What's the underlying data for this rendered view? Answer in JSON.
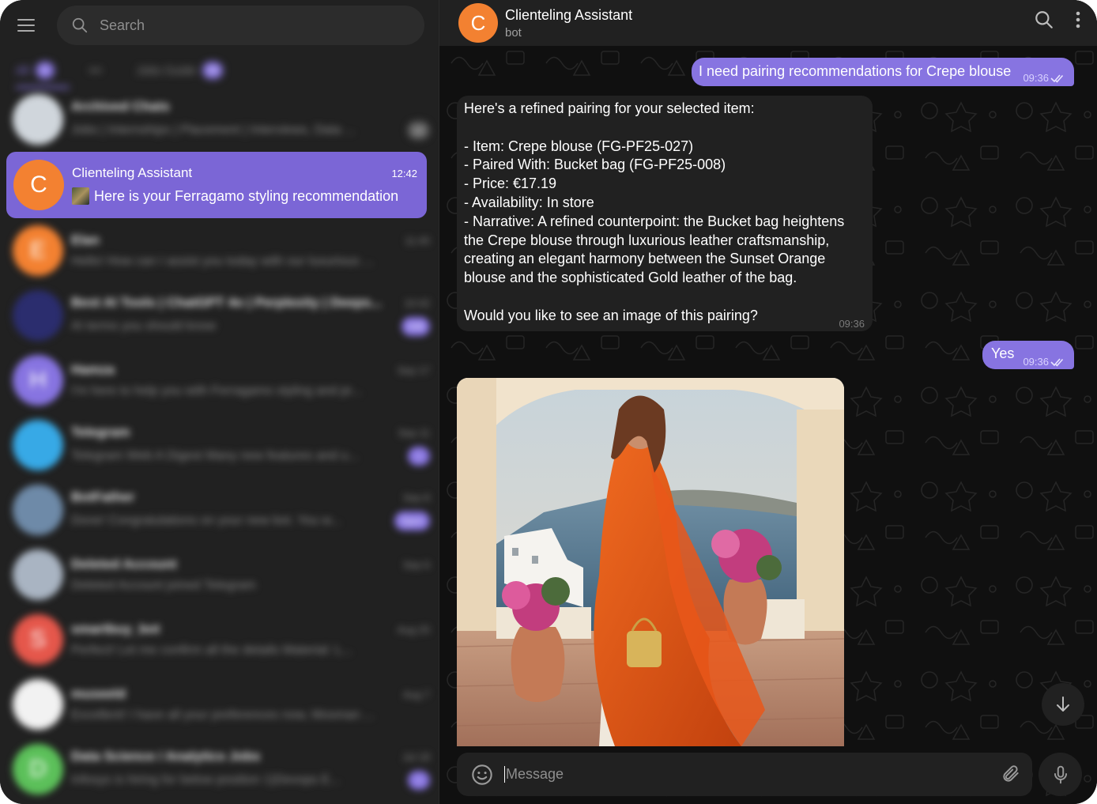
{
  "search": {
    "placeholder": "Search"
  },
  "folders": [
    {
      "label": "All",
      "badge": "8",
      "active": true
    },
    {
      "label": "•••",
      "badge": "",
      "active": false
    },
    {
      "label": "Jobs Guide",
      "badge": "26",
      "active": false
    }
  ],
  "chats": [
    {
      "name": "Archived Chats",
      "time": "",
      "preview": "Jobs | Internships | Placement | Interviews, Data ...",
      "badge": "12",
      "badge_grey": true,
      "avatar_text": "",
      "avatar_color": "#d0d6dc"
    },
    {
      "name": "Clienteling Assistant",
      "time": "12:42",
      "preview": "Here is your Ferragamo styling recommendation",
      "badge": "",
      "avatar_text": "C",
      "avatar_color": "#f38131",
      "selected": true
    },
    {
      "name": "Elan",
      "time": "11:45",
      "preview": "Hello! How can I assist you today with our luxurious ...",
      "badge": "",
      "avatar_text": "E",
      "avatar_color": "#f38131"
    },
    {
      "name": "Best AI Tools | ChatGPT 4o | Perplexity | Deeps...",
      "time": "10:42",
      "preview": "AI terms you should know",
      "badge": "548",
      "avatar_text": "",
      "avatar_color": "#2b2d6e"
    },
    {
      "name": "Hamza",
      "time": "Sep 17",
      "preview": "I'm here to help you with Ferragamo styling and pr...",
      "badge": "",
      "avatar_text": "H",
      "avatar_color": "#8774e1"
    },
    {
      "name": "Telegram",
      "time": "Sep 11",
      "preview": "Telegram Web A Digest Many new features and u...",
      "badge": "1",
      "avatar_text": "",
      "avatar_color": "#37a9e6"
    },
    {
      "name": "BotFather",
      "time": "Sep 8",
      "preview": "Done! Congratulations on your new bot. You w...",
      "badge": "Open",
      "avatar_text": "",
      "avatar_color": "#6e8aa8"
    },
    {
      "name": "Deleted Account",
      "time": "Sep 6",
      "preview": "Deleted Account joined Telegram",
      "badge": "",
      "avatar_text": "",
      "avatar_color": "#a9b4c2"
    },
    {
      "name": "smartbuy_bot",
      "time": "Aug 25",
      "preview": "Perfect! Let me confirm all the details Material: L...",
      "badge": "",
      "avatar_text": "S",
      "avatar_color": "#e5574b"
    },
    {
      "name": "museeld",
      "time": "Aug 7",
      "preview": "Excellent! I have all your preferences now, Mosman ...",
      "badge": "",
      "avatar_text": "",
      "avatar_color": "#f2f2f2"
    },
    {
      "name": "Data Science / Analytics Jobs",
      "time": "Jul 18",
      "preview": "Infosys is hiring for below position 1)Devops E...",
      "badge": "1",
      "avatar_text": "D",
      "avatar_color": "#5cc05a"
    }
  ],
  "header": {
    "title": "Clienteling Assistant",
    "subtitle": "bot",
    "avatar_text": "C"
  },
  "messages": {
    "out1": {
      "text": "I need pairing recommendations for Crepe blouse",
      "time": "09:36"
    },
    "in1": {
      "lines": [
        "Here's a refined pairing for your selected item:",
        "",
        "- Item: Crepe blouse (FG-PF25-027)",
        "- Paired With: Bucket bag (FG-PF25-008)",
        "- Price: €17.19",
        "- Availability: In store",
        "- Narrative: A refined counterpoint: the Bucket bag heightens",
        "the Crepe blouse through luxurious leather craftsmanship,",
        "creating an elegant harmony between the Sunset Orange",
        "blouse and the sophisticated Gold leather of the bag.",
        "",
        "Would you like to see an image of this pairing?"
      ],
      "time": "09:36"
    },
    "out2": {
      "text": "Yes",
      "time": "09:36"
    }
  },
  "composer": {
    "placeholder": "Message"
  },
  "colors": {
    "accent": "#8774e1",
    "selected": "#7b66d6",
    "panel": "#212121",
    "bot_avatar": "#f38131"
  }
}
